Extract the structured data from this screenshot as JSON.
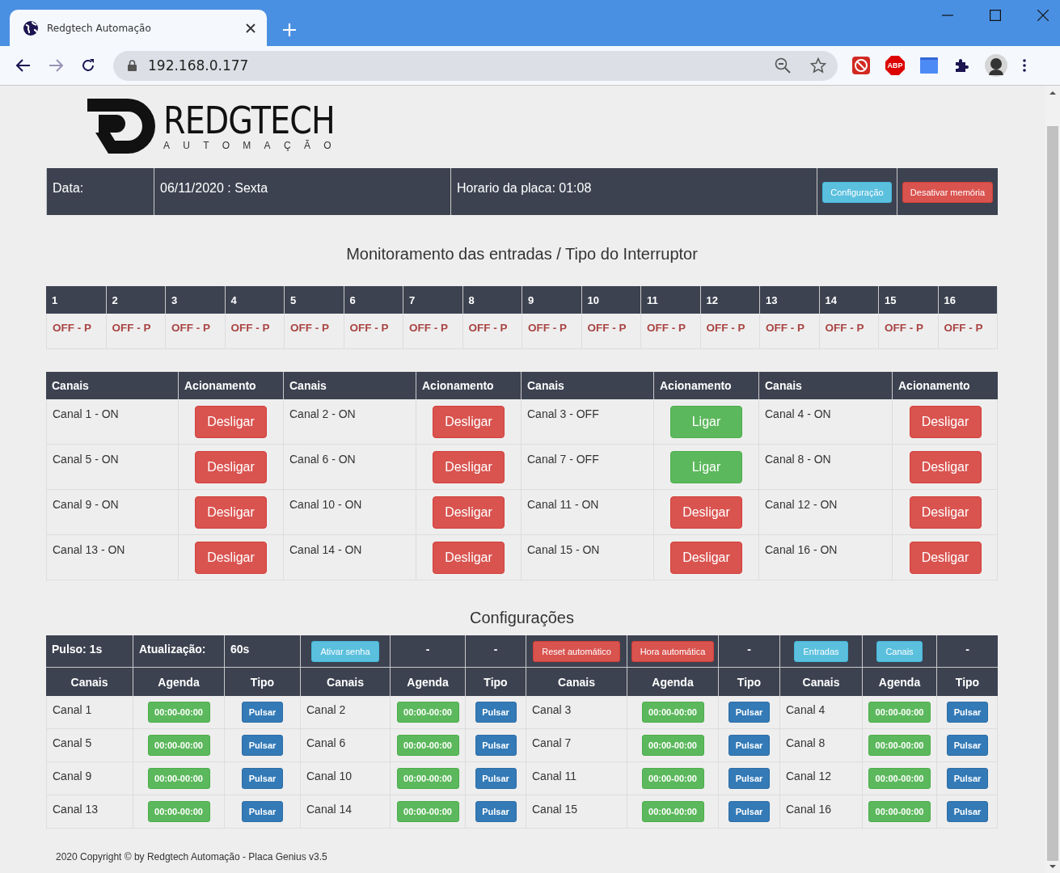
{
  "browser": {
    "tab_title": "Redgtech Automação",
    "address": "192.168.0.177",
    "extension_badge": "ABP"
  },
  "logo": {
    "wordmark": "REDGTECH",
    "tagline": "AUTOMAÇÃO"
  },
  "header": {
    "date_label": "Data:",
    "date": "06/11/2020 : Sexta",
    "board_time": "Horario da placa: 01:08",
    "buttons": [
      {
        "label": "Configuração",
        "kind": "info"
      },
      {
        "label": "Desativar memória",
        "kind": "danger"
      }
    ]
  },
  "inputs": {
    "title": "Monitoramento das entradas / Tipo do Interruptor",
    "items": [
      {
        "number": "1",
        "status": "OFF - P"
      },
      {
        "number": "2",
        "status": "OFF - P"
      },
      {
        "number": "3",
        "status": "OFF - P"
      },
      {
        "number": "4",
        "status": "OFF - P"
      },
      {
        "number": "5",
        "status": "OFF - P"
      },
      {
        "number": "6",
        "status": "OFF - P"
      },
      {
        "number": "7",
        "status": "OFF - P"
      },
      {
        "number": "8",
        "status": "OFF - P"
      },
      {
        "number": "9",
        "status": "OFF - P"
      },
      {
        "number": "10",
        "status": "OFF - P"
      },
      {
        "number": "11",
        "status": "OFF - P"
      },
      {
        "number": "12",
        "status": "OFF - P"
      },
      {
        "number": "13",
        "status": "OFF - P"
      },
      {
        "number": "14",
        "status": "OFF - P"
      },
      {
        "number": "15",
        "status": "OFF - P"
      },
      {
        "number": "16",
        "status": "OFF - P"
      }
    ]
  },
  "channels": {
    "columns": [
      "Canais",
      "Acionamento",
      "Canais",
      "Acionamento",
      "Canais",
      "Acionamento",
      "Canais",
      "Acionamento"
    ],
    "items": [
      {
        "label": "Canal 1 - ON",
        "on": true,
        "action": "Desligar"
      },
      {
        "label": "Canal 2 - ON",
        "on": true,
        "action": "Desligar"
      },
      {
        "label": "Canal 3 - OFF",
        "on": false,
        "action": "Ligar"
      },
      {
        "label": "Canal 4 - ON",
        "on": true,
        "action": "Desligar"
      },
      {
        "label": "Canal 5 - ON",
        "on": true,
        "action": "Desligar"
      },
      {
        "label": "Canal 6 - ON",
        "on": true,
        "action": "Desligar"
      },
      {
        "label": "Canal 7 - OFF",
        "on": false,
        "action": "Ligar"
      },
      {
        "label": "Canal 8 - ON",
        "on": true,
        "action": "Desligar"
      },
      {
        "label": "Canal 9 - ON",
        "on": true,
        "action": "Desligar"
      },
      {
        "label": "Canal 10 - ON",
        "on": true,
        "action": "Desligar"
      },
      {
        "label": "Canal 11 - ON",
        "on": true,
        "action": "Desligar"
      },
      {
        "label": "Canal 12 - ON",
        "on": true,
        "action": "Desligar"
      },
      {
        "label": "Canal 13 - ON",
        "on": true,
        "action": "Desligar"
      },
      {
        "label": "Canal 14 - ON",
        "on": true,
        "action": "Desligar"
      },
      {
        "label": "Canal 15 - ON",
        "on": true,
        "action": "Desligar"
      },
      {
        "label": "Canal 16 - ON",
        "on": true,
        "action": "Desligar"
      }
    ]
  },
  "configuration": {
    "title": "Configurações",
    "bar": [
      {
        "kind": "text",
        "text": "Pulso: 1s"
      },
      {
        "kind": "text",
        "text": "Atualização:"
      },
      {
        "kind": "text",
        "text": "60s"
      },
      {
        "kind": "info",
        "text": "Ativar senha"
      },
      {
        "kind": "dash",
        "text": "-"
      },
      {
        "kind": "dash",
        "text": "-"
      },
      {
        "kind": "danger",
        "text": "Reset automático"
      },
      {
        "kind": "danger",
        "text": "Hora automática"
      },
      {
        "kind": "dash",
        "text": "-"
      },
      {
        "kind": "info",
        "text": "Entradas"
      },
      {
        "kind": "info",
        "text": "Canais"
      },
      {
        "kind": "dash",
        "text": "-"
      }
    ],
    "columns": [
      "Canais",
      "Agenda",
      "Tipo",
      "Canais",
      "Agenda",
      "Tipo",
      "Canais",
      "Agenda",
      "Tipo",
      "Canais",
      "Agenda",
      "Tipo"
    ],
    "items": [
      {
        "name": "Canal 1",
        "schedule": "00:00-00:00",
        "type": "Pulsar"
      },
      {
        "name": "Canal 2",
        "schedule": "00:00-00:00",
        "type": "Pulsar"
      },
      {
        "name": "Canal 3",
        "schedule": "00:00-00:00",
        "type": "Pulsar"
      },
      {
        "name": "Canal 4",
        "schedule": "00:00-00:00",
        "type": "Pulsar"
      },
      {
        "name": "Canal 5",
        "schedule": "00:00-00:00",
        "type": "Pulsar"
      },
      {
        "name": "Canal 6",
        "schedule": "00:00-00:00",
        "type": "Pulsar"
      },
      {
        "name": "Canal 7",
        "schedule": "00:00-00:00",
        "type": "Pulsar"
      },
      {
        "name": "Canal 8",
        "schedule": "00:00-00:00",
        "type": "Pulsar"
      },
      {
        "name": "Canal 9",
        "schedule": "00:00-00:00",
        "type": "Pulsar"
      },
      {
        "name": "Canal 10",
        "schedule": "00:00-00:00",
        "type": "Pulsar"
      },
      {
        "name": "Canal 11",
        "schedule": "00:00-00:00",
        "type": "Pulsar"
      },
      {
        "name": "Canal 12",
        "schedule": "00:00-00:00",
        "type": "Pulsar"
      },
      {
        "name": "Canal 13",
        "schedule": "00:00-00:00",
        "type": "Pulsar"
      },
      {
        "name": "Canal 14",
        "schedule": "00:00-00:00",
        "type": "Pulsar"
      },
      {
        "name": "Canal 15",
        "schedule": "00:00-00:00",
        "type": "Pulsar"
      },
      {
        "name": "Canal 16",
        "schedule": "00:00-00:00",
        "type": "Pulsar"
      }
    ]
  },
  "footer": "2020 Copyright © by Redgtech Automação - Placa Genius v3.5"
}
